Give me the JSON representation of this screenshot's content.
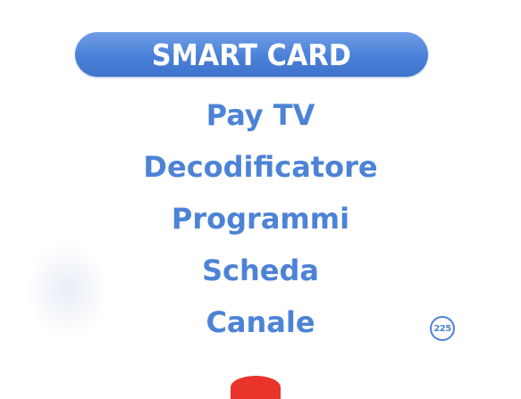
{
  "header": {
    "title": "SMART CARD"
  },
  "menu": {
    "items": [
      {
        "label": "Pay TV"
      },
      {
        "label": "Decodificatore"
      },
      {
        "label": "Programmi"
      },
      {
        "label": "Scheda"
      },
      {
        "label": "Canale"
      }
    ]
  },
  "page_number": "225",
  "colors": {
    "accent": "#4d83d6",
    "header_bg": "#4a80d8",
    "header_text": "#ffffff",
    "background": "#ffffff"
  }
}
